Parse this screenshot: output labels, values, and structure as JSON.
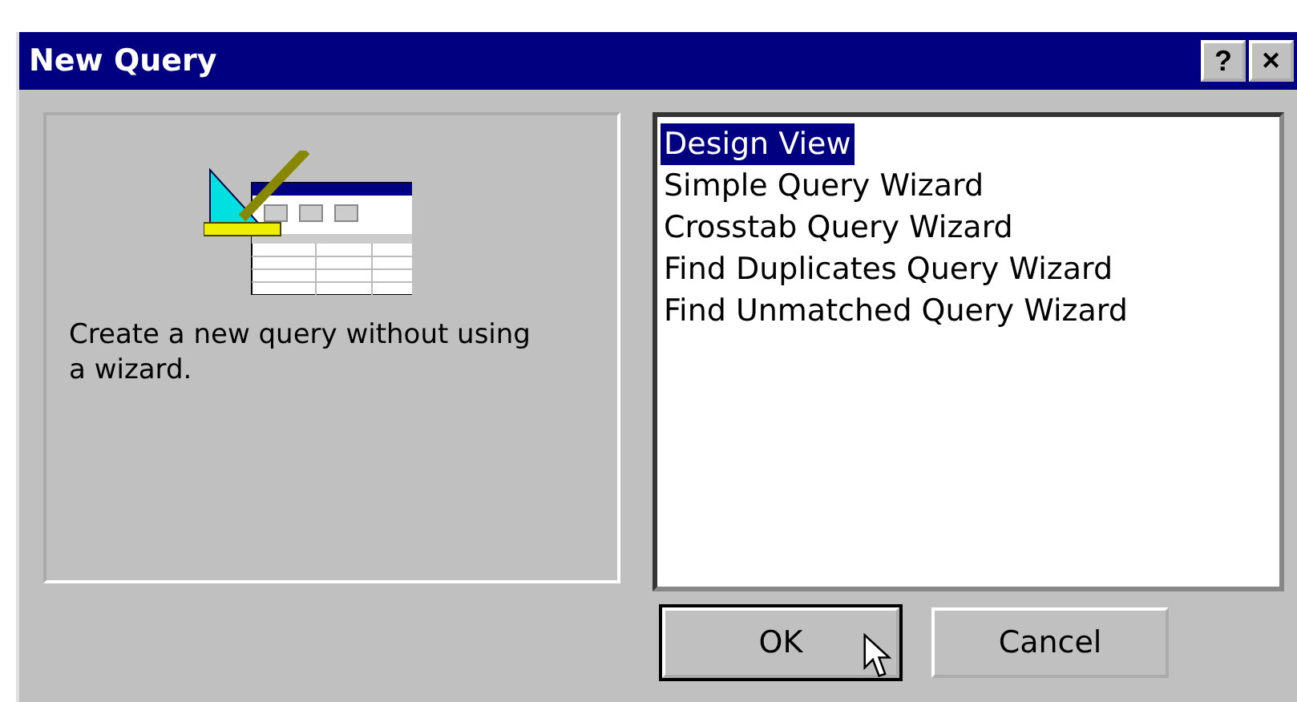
{
  "window": {
    "title": "New Query"
  },
  "title_buttons": [
    {
      "kind": "help",
      "label": "?"
    },
    {
      "kind": "close",
      "label": "✕"
    }
  ],
  "description": "Create a new query without using a wizard.",
  "list": [
    {
      "label": "Design View",
      "selected": true
    },
    {
      "label": "Simple Query Wizard",
      "selected": false
    },
    {
      "label": "Crosstab Query Wizard",
      "selected": false
    },
    {
      "label": "Find Duplicates Query Wizard",
      "selected": false
    },
    {
      "label": "Find Unmatched Query Wizard",
      "selected": false
    }
  ],
  "buttons": [
    {
      "label": "OK",
      "default": true
    },
    {
      "label": "Cancel",
      "default": false
    }
  ]
}
